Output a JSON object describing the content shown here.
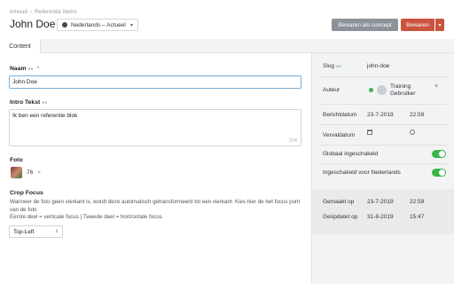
{
  "breadcrumb": {
    "home": "Inhoud",
    "section": "Referentie Items"
  },
  "page": {
    "title": "John Doe"
  },
  "locale": {
    "value": "Nederlands – Actueel"
  },
  "actions": {
    "save_concept": "Bewaren als concept",
    "save": "Bewaren"
  },
  "tabs": [
    {
      "label": "Content"
    }
  ],
  "form": {
    "name": {
      "label": "Naam",
      "required": "*",
      "value": "John Doe"
    },
    "intro": {
      "label": "Intro Tekst",
      "value": "Ik ben een referentie blok",
      "counter": "274"
    },
    "photo": {
      "label": "Foto",
      "id": "76",
      "remove": "×"
    },
    "crop": {
      "label": "Crop Focus",
      "help1": "Wanneer de foto geen vierkant is, wordt deze automatisch getransformeerd tot een vierkant. Kies hier de het focus punt van de foto",
      "help2": "Eerste deel = verticale focus | Tweede deel = horizontale focus",
      "selected": "Top-Left"
    }
  },
  "sidebar": {
    "slug": {
      "label": "Slug",
      "value": "john-doe"
    },
    "author": {
      "label": "Auteur",
      "name": "Training Gebruiker",
      "remove": "×"
    },
    "publish": {
      "label": "Berichtdatum",
      "date": "23-7-2019",
      "time": "22:59"
    },
    "expire": {
      "label": "Vervaldatum"
    },
    "global": {
      "label": "Globaal ingeschakeld",
      "on": true
    },
    "locale_enabled": {
      "label": "Ingeschakeld voor Nederlands",
      "on": true
    },
    "created": {
      "label": "Gemaakt op",
      "date": "23-7-2019",
      "time": "22:59"
    },
    "updated": {
      "label": "Geüpdatet op",
      "date": "31-8-2019",
      "time": "15:47"
    }
  },
  "colors": {
    "accent": "#c9543f",
    "concept": "#8c9299",
    "toggle_on": "#3bb54a",
    "focus": "#7aaed6"
  }
}
